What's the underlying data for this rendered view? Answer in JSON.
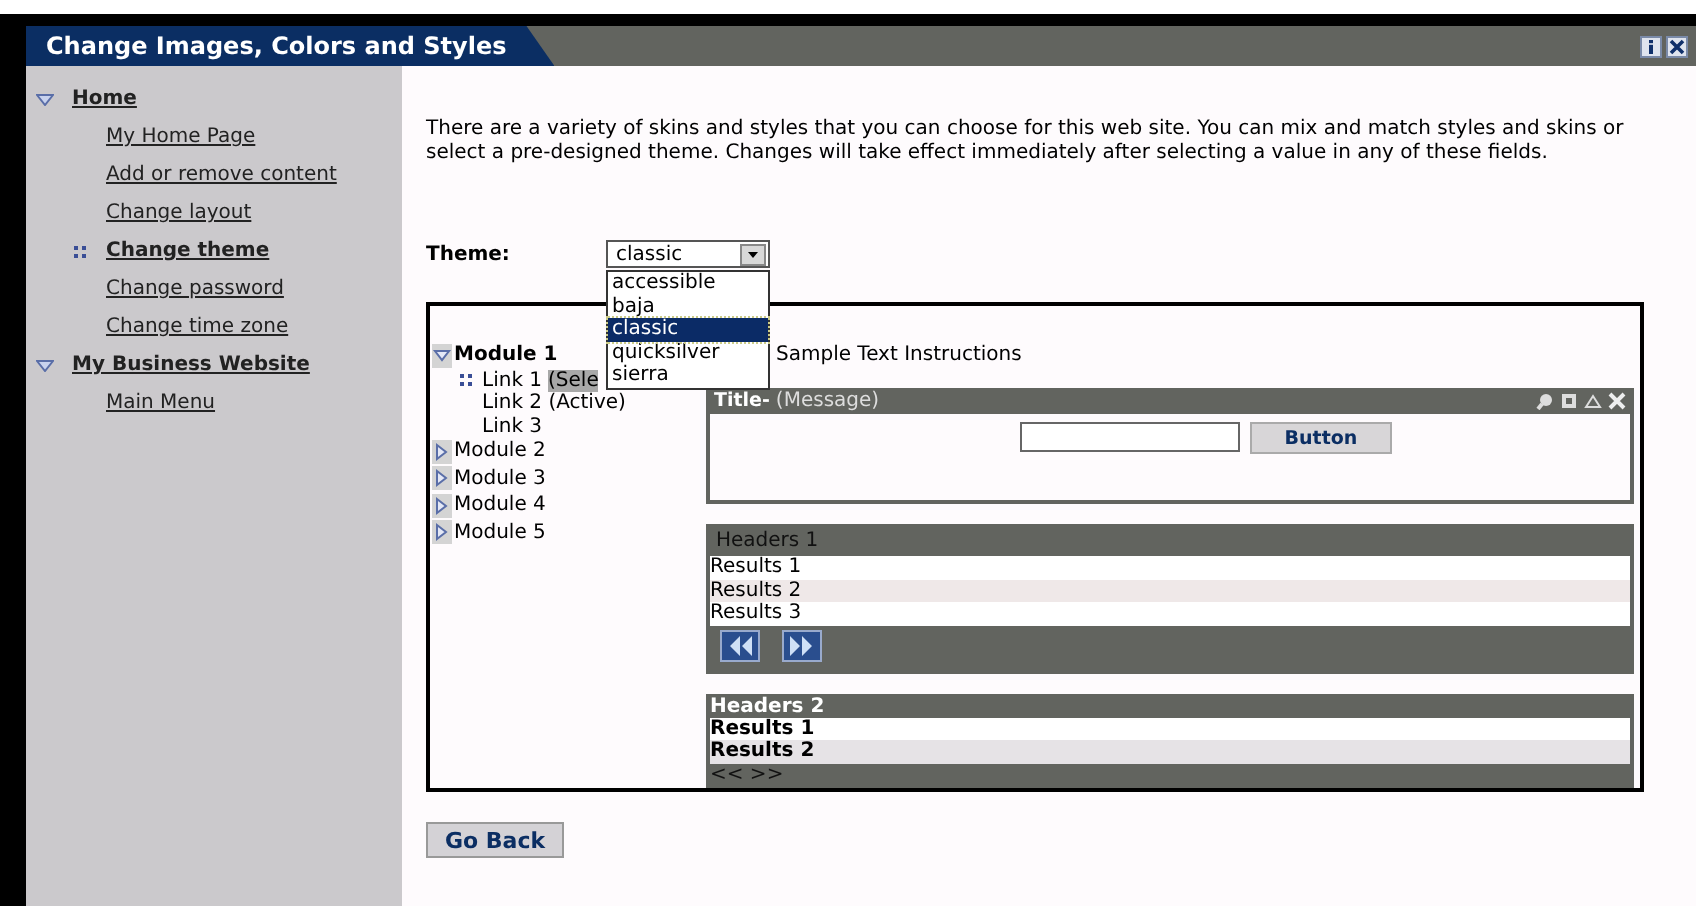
{
  "window": {
    "title": "Change Images, Colors and Styles"
  },
  "sidebar": {
    "items": [
      {
        "label": "Home",
        "expanded": true,
        "children": [
          {
            "label": "My Home Page",
            "selected": false
          },
          {
            "label": "Add or remove content",
            "selected": false
          },
          {
            "label": "Change layout",
            "selected": false
          },
          {
            "label": "Change theme",
            "selected": true
          },
          {
            "label": "Change password",
            "selected": false
          },
          {
            "label": "Change time zone",
            "selected": false
          }
        ]
      },
      {
        "label": "My Business Website",
        "expanded": true,
        "children": [
          {
            "label": "Main Menu",
            "selected": false
          }
        ]
      }
    ]
  },
  "description": "There are a variety of skins and styles that you can choose for this web site. You can mix and match styles and skins or select a pre-designed theme. Changes will take effect immediately after selecting a value in any of these fields.",
  "theme": {
    "label": "Theme:",
    "value": "classic",
    "expanded": true,
    "options": [
      {
        "label": "accessible",
        "selected": false
      },
      {
        "label": "baja",
        "selected": false
      },
      {
        "label": "classic",
        "selected": true
      },
      {
        "label": "quicksilver",
        "selected": false
      },
      {
        "label": "sierra",
        "selected": false
      }
    ]
  },
  "preview": {
    "tree": [
      {
        "label": "Module 1",
        "expanded": true,
        "children": [
          {
            "label": "Link 1",
            "tag": "(Sele",
            "selected": true
          },
          {
            "label": "Link 2 (Active)",
            "selected": false
          },
          {
            "label": "Link 3",
            "selected": false
          }
        ]
      },
      {
        "label": "Module 2",
        "expanded": false
      },
      {
        "label": "Module 3",
        "expanded": false
      },
      {
        "label": "Module 4",
        "expanded": false
      },
      {
        "label": "Module 5",
        "expanded": false
      }
    ],
    "instructions": "Sample Text Instructions",
    "portlet": {
      "title": "Title-",
      "subtitle": "(Message)",
      "button": "Button"
    },
    "tables": [
      {
        "kind": "icons",
        "header": "Headers 1",
        "rows": [
          "Results 1",
          "Results 2",
          "Results 3"
        ]
      },
      {
        "kind": "text",
        "header": "Headers 2",
        "rows": [
          "Results 1",
          "Results 2"
        ],
        "pager": "<< >>"
      }
    ]
  },
  "buttons": [
    "Go Back"
  ]
}
